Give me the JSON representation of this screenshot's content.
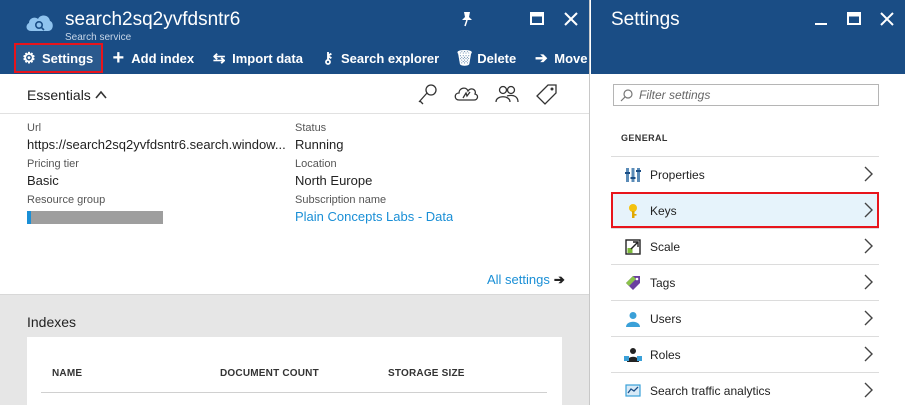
{
  "left_blade": {
    "title": "search2sq2yvfdsntr6",
    "subtitle": "Search service",
    "window_controls": [
      "pin-icon",
      "maximize-icon",
      "close-icon"
    ],
    "toolbar": [
      {
        "label": "Settings",
        "icon": "gear-icon",
        "active": true
      },
      {
        "label": "Add index",
        "icon": "plus-icon"
      },
      {
        "label": "Import data",
        "icon": "import-icon"
      },
      {
        "label": "Search explorer",
        "icon": "search-explorer-icon"
      },
      {
        "label": "Delete",
        "icon": "trash-icon"
      },
      {
        "label": "Move",
        "icon": "arrow-right-icon"
      }
    ],
    "essentials": {
      "title": "Essentials",
      "icons": [
        "key-icon",
        "cloud-icon",
        "users-icon",
        "tag-icon"
      ],
      "url_label": "Url",
      "url_value": "https://search2sq2yvfdsntr6.search.window...",
      "pricing_label": "Pricing tier",
      "pricing_value": "Basic",
      "rg_label": "Resource group",
      "status_label": "Status",
      "status_value": "Running",
      "location_label": "Location",
      "location_value": "North Europe",
      "sub_label": "Subscription name",
      "sub_value": "Plain Concepts Labs - Data",
      "all_settings": "All settings"
    },
    "indexes": {
      "title": "Indexes",
      "columns": [
        "NAME",
        "DOCUMENT COUNT",
        "STORAGE SIZE"
      ]
    }
  },
  "right_blade": {
    "title": "Settings",
    "filter_placeholder": "Filter settings",
    "group": "GENERAL",
    "items": [
      {
        "label": "Properties",
        "icon": "properties-icon"
      },
      {
        "label": "Keys",
        "icon": "key-icon",
        "selected": true
      },
      {
        "label": "Scale",
        "icon": "scale-icon"
      },
      {
        "label": "Tags",
        "icon": "tag-icon"
      },
      {
        "label": "Users",
        "icon": "users-icon"
      },
      {
        "label": "Roles",
        "icon": "roles-icon"
      },
      {
        "label": "Search traffic analytics",
        "icon": "analytics-icon"
      }
    ]
  },
  "colors": {
    "header_bg": "#1a4d85",
    "accent_link": "#1a8fd6",
    "highlight_red": "#e8141b",
    "selected_bg": "#e6f3fb"
  }
}
